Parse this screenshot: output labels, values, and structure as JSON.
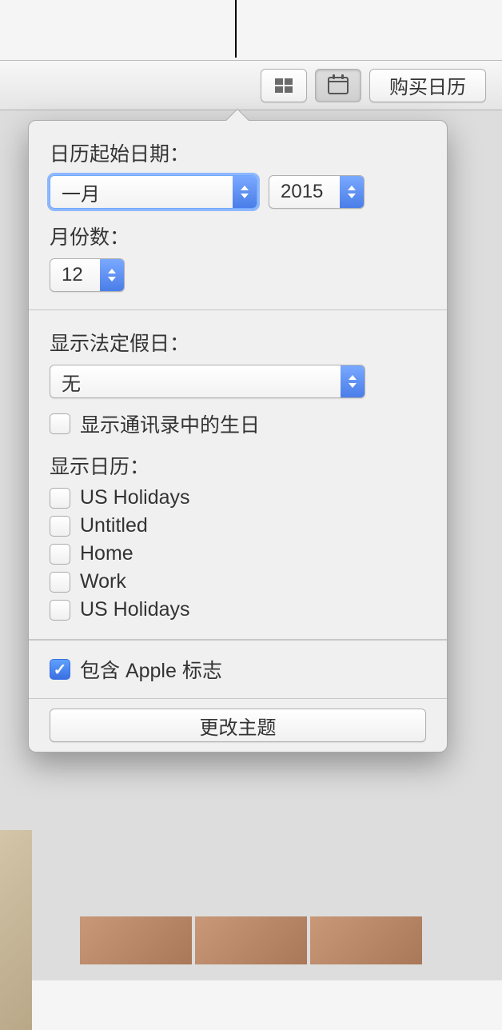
{
  "toolbar": {
    "buy_label": "购买日历"
  },
  "popover": {
    "start_date_label": "日历起始日期：",
    "month_value": "一月",
    "year_value": "2015",
    "months_count_label": "月份数：",
    "months_count_value": "12",
    "holidays_label": "显示法定假日：",
    "holidays_value": "无",
    "show_birthdays_label": "显示通讯录中的生日",
    "show_calendars_label": "显示日历：",
    "calendars": [
      {
        "label": "US Holidays",
        "checked": false
      },
      {
        "label": "Untitled",
        "checked": false
      },
      {
        "label": "Home",
        "checked": false
      },
      {
        "label": "Work",
        "checked": false
      },
      {
        "label": "US Holidays",
        "checked": false
      }
    ],
    "include_apple_logo_label": "包含 Apple 标志",
    "change_theme_label": "更改主题"
  }
}
